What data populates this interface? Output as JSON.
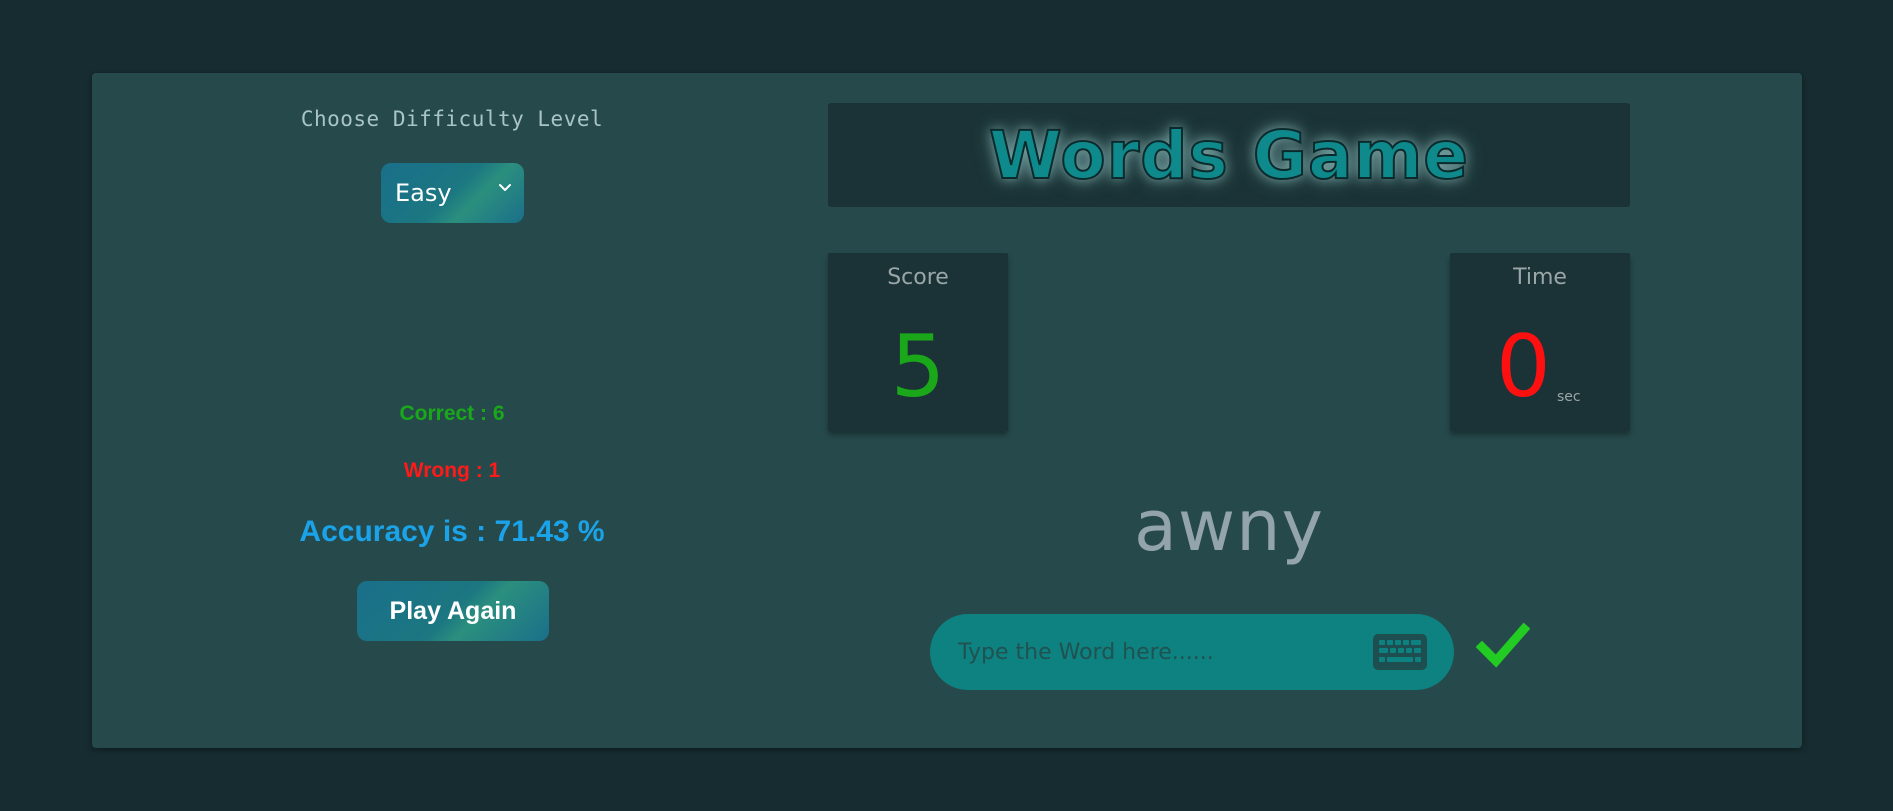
{
  "difficulty": {
    "label": "Choose Difficulty Level",
    "selected": "Easy"
  },
  "header": {
    "title": "Words Game"
  },
  "score": {
    "label": "Score",
    "value": "5"
  },
  "time": {
    "label": "Time",
    "value": "0",
    "unit": "sec"
  },
  "results": {
    "correct": "Correct : 6",
    "wrong": "Wrong : 1",
    "accuracy": "Accuracy is : 71.43 %",
    "play_again": "Play Again"
  },
  "word": {
    "current": "awny",
    "input_value": "",
    "input_placeholder": "Type the Word here......"
  },
  "colors": {
    "background": "#162c30",
    "panel": "#264a4c",
    "card": "#1b3336",
    "correct": "#1aa81a",
    "wrong": "#ff1a1a",
    "accuracy": "#1aa3e8",
    "title": "#0f8a8c",
    "input": "#0e8181",
    "check": "#22cc22"
  },
  "icons": {
    "select_arrow": "chevron-down-icon",
    "keyboard": "keyboard-icon",
    "submit": "checkmark-icon"
  }
}
